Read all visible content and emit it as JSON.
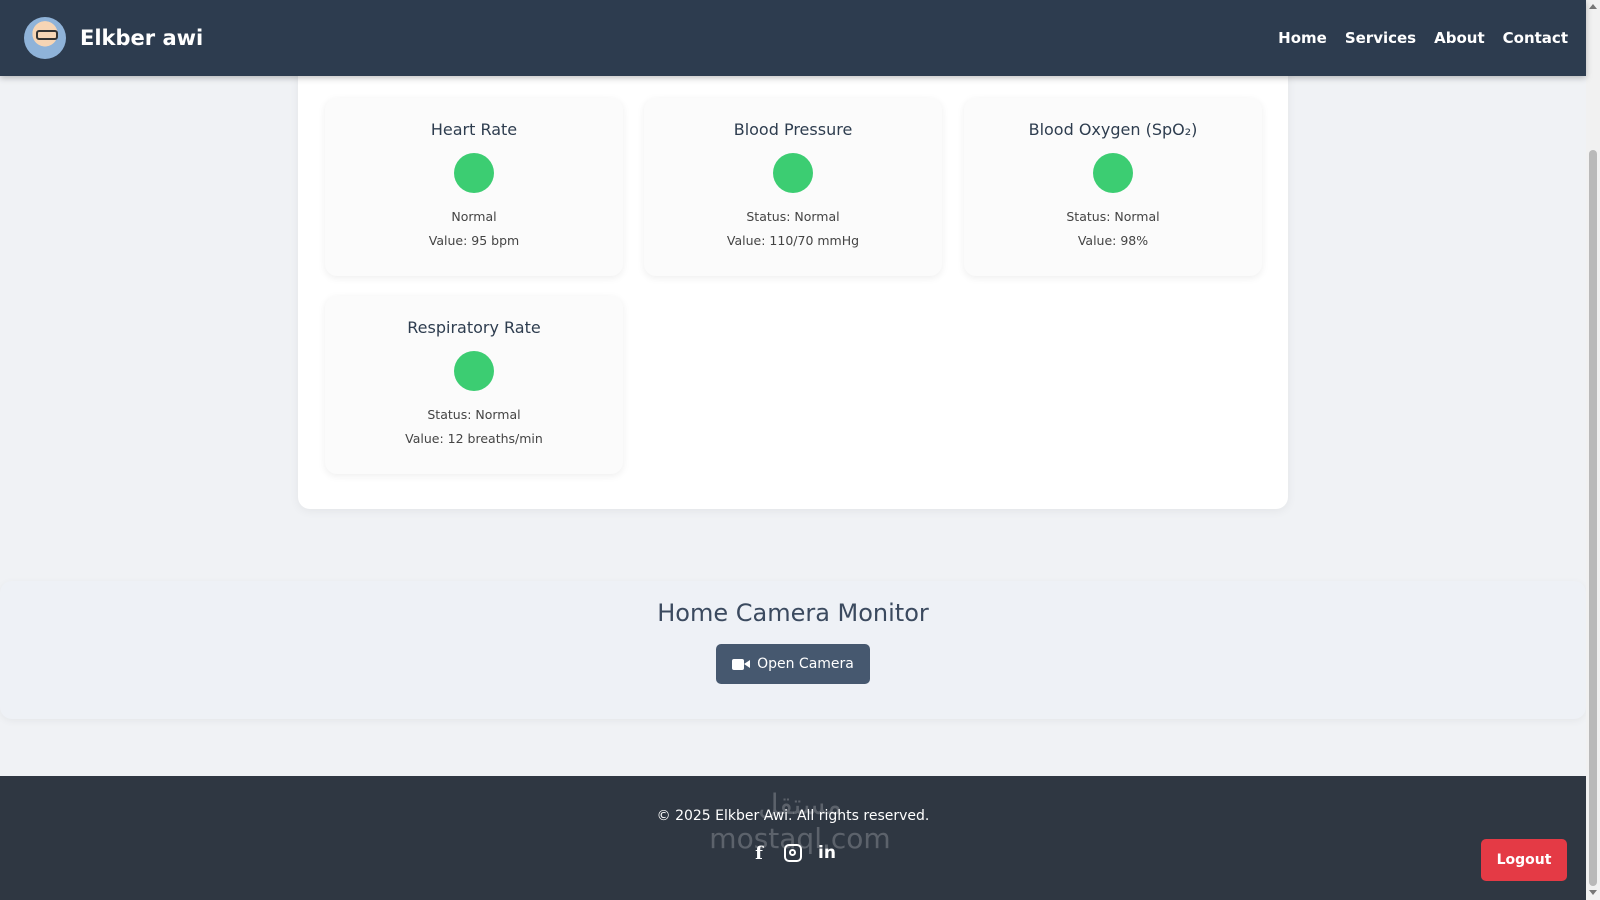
{
  "header": {
    "brand": "Elkber awi",
    "nav": [
      "Home",
      "Services",
      "About",
      "Contact"
    ]
  },
  "vitals": [
    {
      "title": "Heart Rate",
      "status": "Normal",
      "value": "Value: 95 bpm",
      "color": "#3ccd72"
    },
    {
      "title": "Blood Pressure",
      "status": "Status: Normal",
      "value": "Value: 110/70 mmHg",
      "color": "#3ccd72"
    },
    {
      "title": "Blood Oxygen (SpO₂)",
      "status": "Status: Normal",
      "value": "Value: 98%",
      "color": "#3ccd72"
    },
    {
      "title": "Respiratory Rate",
      "status": "Status: Normal",
      "value": "Value: 12 breaths/min",
      "color": "#3ccd72"
    }
  ],
  "camera": {
    "title": "Home Camera Monitor",
    "button": "Open Camera",
    "icon": "video-camera-icon"
  },
  "footer": {
    "copyright": "© 2025 Elkber Awi. All rights reserved.",
    "socials": [
      "facebook-icon",
      "instagram-icon",
      "linkedin-icon"
    ],
    "watermark": "مستقل mostaql.com",
    "logout": "Logout"
  },
  "colors": {
    "header": "#2d3c4f",
    "status_normal": "#3ccd72",
    "button": "#46586f",
    "footer": "#2f3742",
    "logout": "#e43a45"
  }
}
